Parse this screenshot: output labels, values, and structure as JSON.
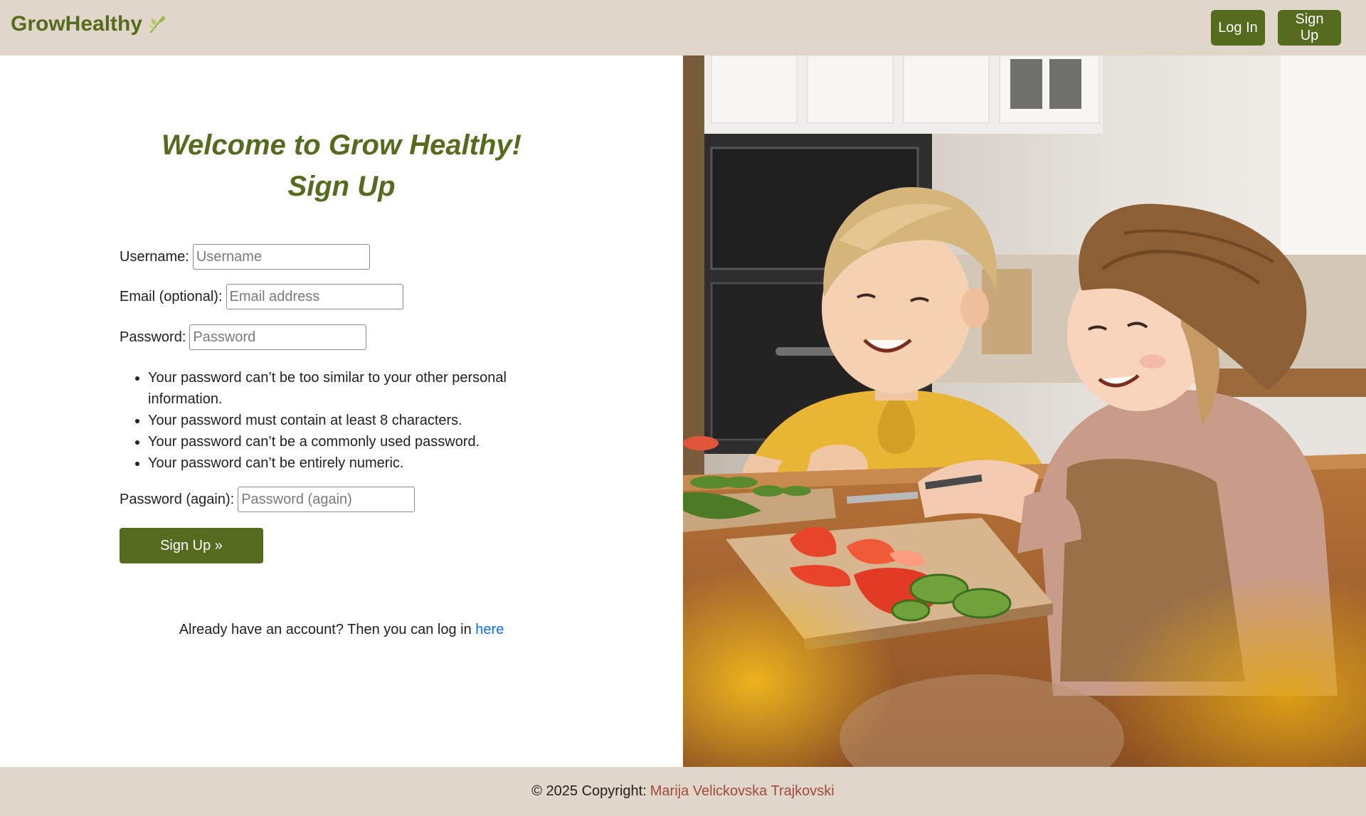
{
  "header": {
    "brand": "GrowHealthy",
    "brand_icon": "leaf-sprout-icon",
    "login_label": "Log In",
    "signup_label": "Sign Up"
  },
  "form": {
    "title_line1": "Welcome to Grow Healthy!",
    "title_line2": "Sign Up",
    "username_label": "Username:",
    "username_placeholder": "Username",
    "username_value": "",
    "email_label": "Email (optional):",
    "email_placeholder": "Email address",
    "email_value": "",
    "password_label": "Password:",
    "password_placeholder": "Password",
    "password_value": "",
    "password_help": [
      "Your password can’t be too similar to your other personal information.",
      "Your password must contain at least 8 characters.",
      "Your password can’t be a commonly used password.",
      "Your password can’t be entirely numeric."
    ],
    "password2_label": "Password (again):",
    "password2_placeholder": "Password (again)",
    "password2_value": "",
    "submit_label": "Sign Up »",
    "login_prompt": "Already have an account? Then you can log in",
    "login_link": "here"
  },
  "footer": {
    "copyright": "© 2025 Copyright:",
    "author": "Marija Velickovska Trajkovski"
  },
  "colors": {
    "brand_green": "#556b1e",
    "header_bg": "#e0d6ca",
    "link_blue": "#0d6efd",
    "author_red": "#a34b3a"
  }
}
